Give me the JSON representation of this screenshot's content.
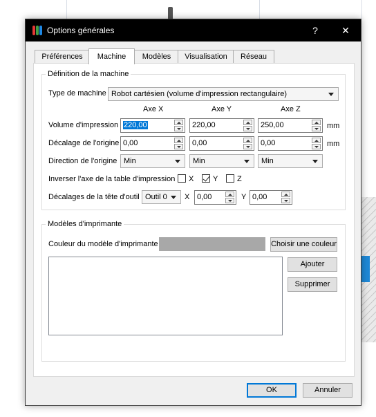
{
  "window": {
    "title": "Options générales",
    "help_label": "?",
    "close_label": "✕"
  },
  "tabs": [
    {
      "label": "Préférences"
    },
    {
      "label": "Machine",
      "active": true
    },
    {
      "label": "Modèles"
    },
    {
      "label": "Visualisation"
    },
    {
      "label": "Réseau"
    }
  ],
  "machine": {
    "group_title": "Définition de la machine",
    "type_label": "Type de machine",
    "type_value": "Robot cartésien (volume d'impression rectangulaire)",
    "axis_headers": [
      "Axe X",
      "Axe Y",
      "Axe Z"
    ],
    "volume": {
      "label": "Volume d'impression",
      "values": [
        "220,00",
        "220,00",
        "250,00"
      ],
      "unit": "mm"
    },
    "offset": {
      "label": "Décalage de l'origine",
      "values": [
        "0,00",
        "0,00",
        "0,00"
      ],
      "unit": "mm"
    },
    "direction": {
      "label": "Direction de l'origine",
      "values": [
        "Min",
        "Min",
        "Min"
      ]
    },
    "invert": {
      "label": "Inverser l'axe de la table d'impression",
      "items": [
        {
          "label": "X",
          "checked": false
        },
        {
          "label": "Y",
          "checked": true
        },
        {
          "label": "Z",
          "checked": false
        }
      ]
    },
    "head_offsets": {
      "label": "Décalages de la tête d'outil",
      "tool_value": "Outil 0",
      "x_label": "X",
      "x_value": "0,00",
      "y_label": "Y",
      "y_value": "0,00"
    }
  },
  "printer_models": {
    "group_title": "Modèles d'imprimante",
    "color_label": "Couleur du modèle d'imprimante",
    "color_value": "#a8a8a8",
    "choose_color_label": "Choisir une couleur",
    "add_label": "Ajouter",
    "remove_label": "Supprimer"
  },
  "footer": {
    "ok_label": "OK",
    "cancel_label": "Annuler"
  },
  "colors": {
    "accent": "#0078d7",
    "titlebar": "#000000"
  }
}
